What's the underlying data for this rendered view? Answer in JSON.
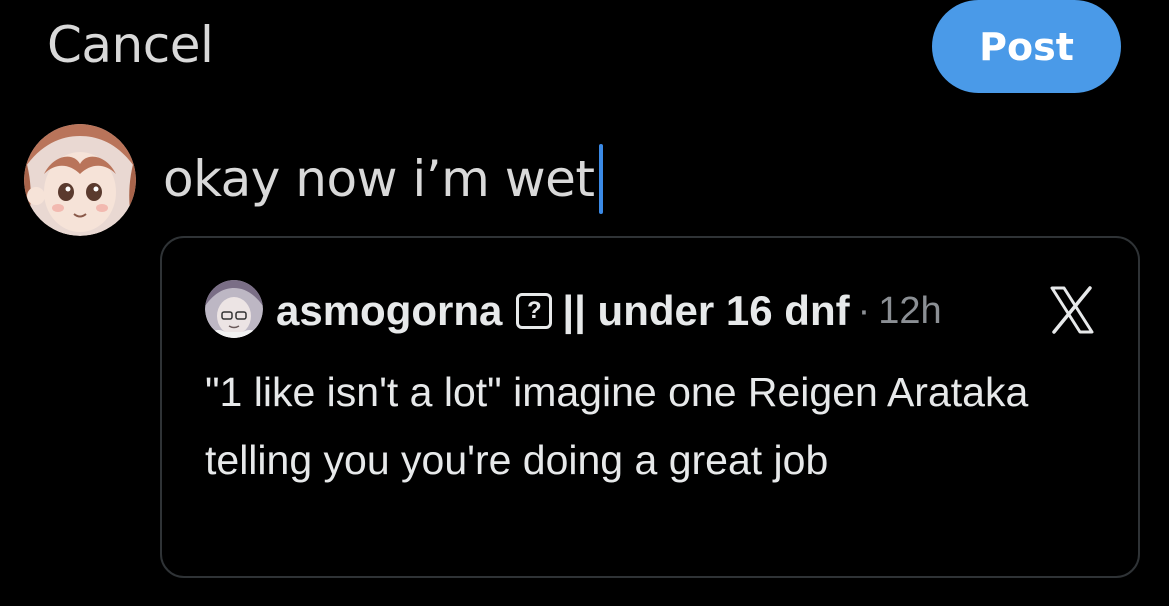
{
  "header": {
    "cancel_label": "Cancel",
    "post_label": "Post"
  },
  "compose": {
    "text": "okay now i’m wet"
  },
  "quote": {
    "display_name": "asmogorna",
    "badge": "?",
    "name_suffix": "|| under 16 dnf",
    "separator": "·",
    "time": "12h",
    "body": "\"1 like isn't a lot\" imagine one Reigen Arataka telling you you're doing a great job"
  },
  "icons": {
    "close": "close-x-icon"
  },
  "colors": {
    "background": "#000000",
    "post_button": "#4a9ae8",
    "caret": "#3b8ae6",
    "card_border": "#2f3336",
    "muted_text": "#8b8f94"
  }
}
